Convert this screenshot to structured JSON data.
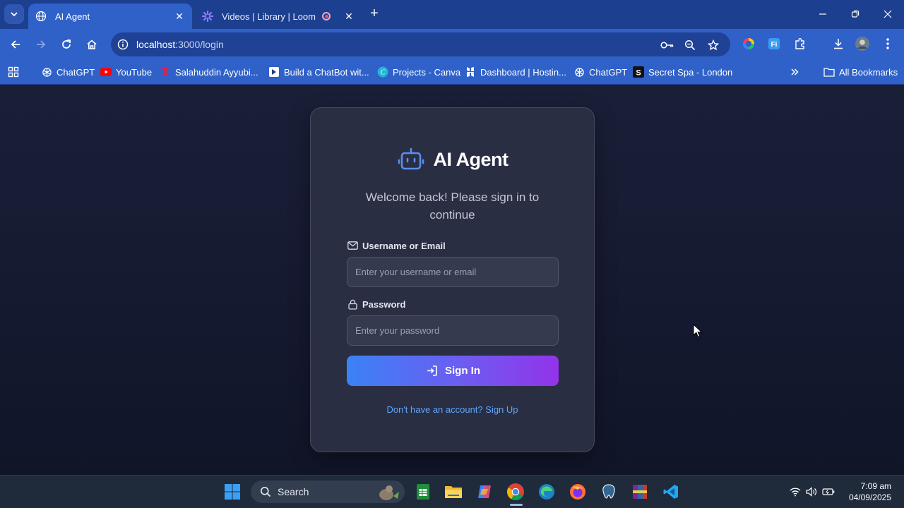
{
  "browser": {
    "tabs": [
      {
        "title": "AI Agent",
        "active": true
      },
      {
        "title": "Videos | Library | Loom",
        "active": false
      }
    ],
    "address_bar": {
      "host": "localhost",
      "path": ":3000/login"
    },
    "bookmarks": [
      {
        "label": "ChatGPT",
        "icon": "chatgpt-icon"
      },
      {
        "label": "YouTube",
        "icon": "youtube-icon"
      },
      {
        "label": "Salahuddin Ayyubi...",
        "icon": "bookmark-icon"
      },
      {
        "label": "Build a ChatBot wit...",
        "icon": "bookmark-icon"
      },
      {
        "label": "Projects - Canva",
        "icon": "canva-icon"
      },
      {
        "label": "Dashboard | Hostin...",
        "icon": "hostinger-icon"
      },
      {
        "label": "ChatGPT",
        "icon": "chatgpt-icon"
      },
      {
        "label": "Secret Spa - London",
        "icon": "bookmark-icon"
      }
    ],
    "all_bookmarks": "All Bookmarks"
  },
  "login": {
    "brand_title": "AI Agent",
    "subtitle": "Welcome back! Please sign in to continue",
    "username_label": "Username or Email",
    "username_placeholder": "Enter your username or email",
    "username_value": "",
    "password_label": "Password",
    "password_placeholder": "Enter your password",
    "password_value": "",
    "submit_label": "Sign In",
    "signup_link": "Don't have an account? Sign Up"
  },
  "taskbar": {
    "search_label": "Search",
    "time": "7:09 am",
    "date": "04/09/2025"
  },
  "colors": {
    "accent_start": "#3b82f6",
    "accent_end": "#9333ea",
    "link": "#60a5fa",
    "card_bg": "#2a2e43",
    "page_bg": "#161a31",
    "chrome_blue": "#2f61c9"
  }
}
